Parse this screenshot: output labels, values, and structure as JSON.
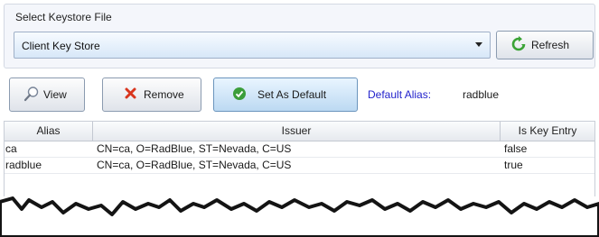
{
  "keystore_group": {
    "title": "Select Keystore File",
    "selected_keystore": "Client Key Store",
    "refresh_label": "Refresh"
  },
  "toolbar": {
    "view_label": "View",
    "remove_label": "Remove",
    "set_default_label": "Set As Default",
    "default_alias_caption": "Default Alias:",
    "default_alias_value": "radblue"
  },
  "table": {
    "columns": [
      "Alias",
      "Issuer",
      "Is Key Entry"
    ],
    "rows": [
      [
        "ca",
        "CN=ca, O=RadBlue, ST=Nevada, C=US",
        "false"
      ],
      [
        "radblue",
        "CN=ca, O=RadBlue, ST=Nevada, C=US",
        "true"
      ]
    ]
  },
  "colors": {
    "default_alias_caption": "#2222cc",
    "refresh_icon": "#3aa335",
    "remove_icon": "#d9361e",
    "set_default_icon": "#3b9e3a",
    "combo_gradient_bottom": "#d7e7f8"
  },
  "icons": {
    "refresh": "refresh-icon",
    "view": "magnifier-icon",
    "remove": "remove-x-icon",
    "set_default": "check-circle-icon",
    "combo": "chevron-down-icon"
  }
}
